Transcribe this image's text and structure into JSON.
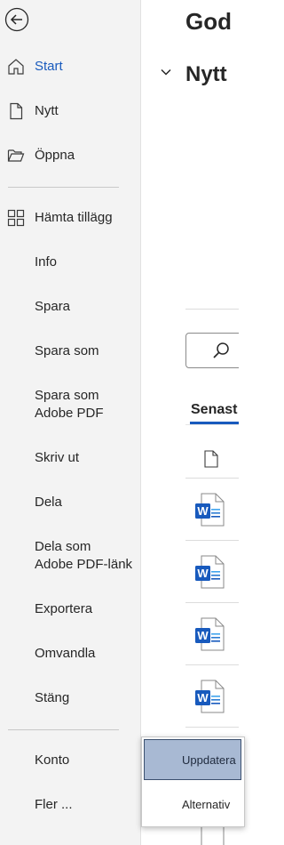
{
  "sidebar": {
    "back_icon": "back-arrow-icon",
    "items": [
      {
        "label": "Start",
        "icon": "home-icon",
        "active": true
      },
      {
        "label": "Nytt",
        "icon": "new-document-icon"
      },
      {
        "label": "Öppna",
        "icon": "open-folder-icon"
      },
      {
        "label": "Hämta tillägg",
        "icon": "add-ins-grid-icon"
      },
      {
        "label": "Info"
      },
      {
        "label": "Spara"
      },
      {
        "label": "Spara som"
      },
      {
        "label": "Spara som",
        "label2": "Adobe PDF"
      },
      {
        "label": "Skriv ut"
      },
      {
        "label": "Dela"
      },
      {
        "label": "Dela som",
        "label2": "Adobe PDF-länk"
      },
      {
        "label": "Exportera"
      },
      {
        "label": "Omvandla"
      },
      {
        "label": "Stäng"
      },
      {
        "label": "Konto"
      },
      {
        "label": "Fler ..."
      }
    ]
  },
  "main": {
    "greeting": "God",
    "new_section_title": "Nytt",
    "recent_tab": "Senast",
    "file_column_icon": "document-icon",
    "file_rows": [
      "word-document-icon",
      "word-document-icon",
      "word-document-icon",
      "word-document-icon"
    ]
  },
  "popup": {
    "update_label": "Uppdatera",
    "options_label": "Alternativ"
  },
  "colors": {
    "accent": "#185abd",
    "sidebar_bg": "#f3f3f3",
    "update_button_bg": "#a8b9d3"
  }
}
